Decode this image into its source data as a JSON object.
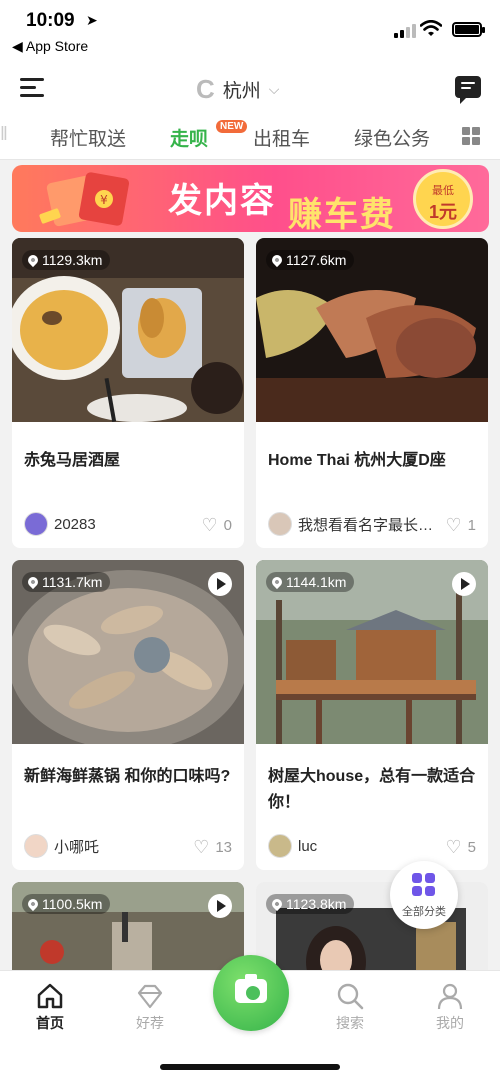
{
  "status_bar": {
    "time": "10:09",
    "back_label": "◀ App Store"
  },
  "header": {
    "city": "杭州"
  },
  "tabs": [
    {
      "label": "帮忙取送"
    },
    {
      "label": "走呗",
      "badge": "NEW"
    },
    {
      "label": "出租车"
    },
    {
      "label": "绿色公务"
    }
  ],
  "banner": {
    "text_main": "发内容",
    "text_accent": "赚车费",
    "coin_top": "最低",
    "coin_value": "1元"
  },
  "cards": [
    {
      "distance": "1129.3km",
      "title": "赤兔马居酒屋",
      "user": "20283",
      "likes": "0",
      "video": false
    },
    {
      "distance": "1127.6km",
      "title": "Home Thai 杭州大厦D座",
      "user": "我想看看名字最长可以多长",
      "likes": "1",
      "video": false
    },
    {
      "distance": "1131.7km",
      "title": "新鲜海鲜蒸锅 和你的口味吗?",
      "user": "小哪吒",
      "likes": "13",
      "video": true
    },
    {
      "distance": "1144.1km",
      "title": "树屋大house，总有一款适合你！",
      "user": "luc",
      "likes": "5",
      "video": true
    },
    {
      "distance": "1100.5km",
      "video": true
    },
    {
      "distance": "1123.8km",
      "video": false
    }
  ],
  "fab": {
    "label": "全部分类"
  },
  "tabbar": [
    {
      "label": "首页"
    },
    {
      "label": "好荐"
    },
    {
      "label": "搜索"
    },
    {
      "label": "我的"
    }
  ],
  "colors": {
    "accent": "#35b34a",
    "badge": "#f26b3a",
    "category": "#6f56e8"
  }
}
